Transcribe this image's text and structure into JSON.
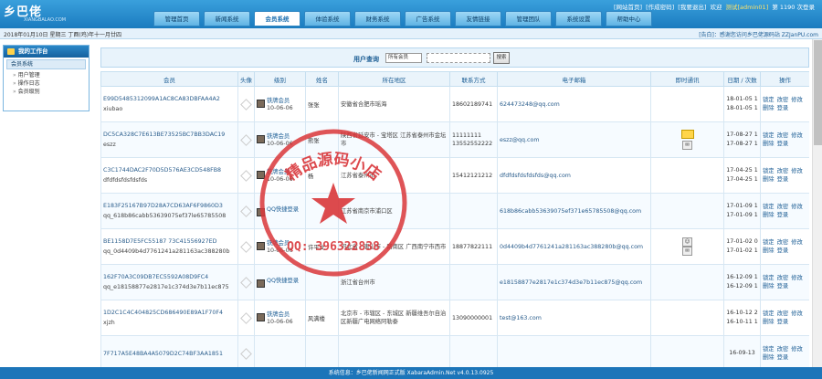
{
  "header": {
    "logo": "乡巴佬",
    "logo_sub": "XIANGBALAO.COM",
    "links": [
      "[网站首页]",
      "[作成密码]",
      "[我要退出]",
      "欢迎",
      "测试[admin01]",
      "第 1190 次登录"
    ]
  },
  "nav": [
    "管理首页",
    "新闻系统",
    "会员系统",
    "体验系统",
    "财务系统",
    "广告系统",
    "友情链接",
    "管理团队",
    "系统设置",
    "帮助中心"
  ],
  "nav_active": 2,
  "info_bar": {
    "date": "2018年01月10日 星期三 丁酉(鸡)年十一月廿四",
    "notice": "[告白]：感谢您访问乡巴佬源码站 ZZJanPU.com"
  },
  "sidebar": {
    "title": "我的工作台",
    "group": "会员系统",
    "items": [
      "用户管理",
      "操作日志",
      "会员级别"
    ]
  },
  "filter": {
    "label": "用户查询",
    "select": "所有会员",
    "button": "搜索"
  },
  "table": {
    "headers": [
      "会员",
      "头像",
      "级别",
      "姓名",
      "所在地区",
      "联系方式",
      "电子邮箱",
      "即时通讯",
      "日期 / 次数",
      "操作"
    ],
    "rows": [
      {
        "id": "E99D5485312099A1AC8CA83DBFAA4A2",
        "name": "xiubao",
        "level": "铁牌会员",
        "level_date": "10-06-06",
        "realname": "张张",
        "region": "安徽省合肥市瑶海",
        "phone": "18602189741",
        "email": "624473248@qq.com",
        "im": "",
        "date1": "18-01-05",
        "date2": "18-01-05",
        "count1": "1",
        "count2": "1"
      },
      {
        "id": "DC5CA328C7E613BE73525BC7BB3DAC19",
        "name": "eszz",
        "level": "铁牌会员",
        "level_date": "10-06-06",
        "realname": "熊张",
        "region": "陕西省延安市 - 宝塔区 江苏省泰州市金坛市",
        "phone": "11111111 13552552222",
        "email": "eszz@qq.com",
        "im": "QQ",
        "date1": "17-08-27",
        "date2": "17-08-27",
        "count1": "1",
        "count2": "1"
      },
      {
        "id": "C3C1744DAC2F70D5D576AE3CD548FB8",
        "name": "dfdfdsfdsfdsfds",
        "level": "铁牌会员",
        "level_date": "10-06-06",
        "realname": "杨",
        "region": "江苏省泰州市",
        "phone": "15412121212",
        "email": "dfdfdsfdsfdsfds@qq.com",
        "im": "",
        "date1": "17-04-25",
        "date2": "17-04-25",
        "count1": "1",
        "count2": "1"
      },
      {
        "id": "E183F25167B97D28A7CD63AF6F9860D3",
        "name": "qq_618b86cabb53639075ef37le65785508",
        "level": "QQ快捷登录",
        "level_date": "",
        "realname": "",
        "region": "江苏省南京市浦口区",
        "phone": "",
        "email": "618b86cabb53639075ef371e65785508@qq.com",
        "im": "",
        "date1": "17-01-09",
        "date2": "17-01-09",
        "count1": "1",
        "count2": "1"
      },
      {
        "id": "BE1158D7E5FC55187 73C41556927ED",
        "name": "qq_0d4409b4d7761241a281163ac388280b",
        "level": "铁牌会员",
        "level_date": "10-06-06",
        "realname": "许平文",
        "region": "河北省 - 唐山市 - 路南区 广西南宁市西市",
        "phone": "18877822111",
        "email": "0d4409b4d7761241a281163ac388280b@qq.com",
        "im": "QQ 旺旺",
        "date1": "17-01-02",
        "date2": "17-01-02",
        "count1": "0",
        "count2": "1"
      },
      {
        "id": "162F70A3C09DB7EC5592A08D9FC4",
        "name": "qq_e18158877e2817e1c374d3e7b11ec875",
        "level": "QQ快捷登录",
        "level_date": "",
        "realname": "",
        "region": "浙江省台州市",
        "phone": "",
        "email": "e18158877e2817e1c374d3e7b11ec875@qq.com",
        "im": "",
        "date1": "16-12-09",
        "date2": "16-12-09",
        "count1": "1",
        "count2": "1"
      },
      {
        "id": "1D2C1C4C404825CD686490E89A1F70F4",
        "name": "xjzh",
        "level": "铁牌会员",
        "level_date": "10-06-06",
        "realname": "风满楼",
        "region": "北京市 - 市辖区 - 东城区 新疆维吾尔自治区新疆广电网络阿勒泰",
        "phone": "13090000001",
        "email": "test@163.com",
        "im": "",
        "date1": "16-10-12",
        "date2": "16-10-11",
        "count1": "2",
        "count2": "1"
      },
      {
        "id": "7F717A5E48BA4A5079D2C74BF3AA1851",
        "name": "",
        "level": "",
        "level_date": "",
        "realname": "",
        "region": "",
        "phone": "",
        "email": "",
        "im": "",
        "date1": "16-09-13",
        "date2": "",
        "count1": "",
        "count2": ""
      }
    ],
    "ops": [
      "锁定",
      "改密",
      "修改",
      "删除",
      "登录"
    ]
  },
  "stamp": {
    "text": "精品源码小店",
    "qq": "QQ: 396322838"
  },
  "footer": "系统信息：乡巴佬新闻网正式版 XabaraAdmin.Net v4.0.13.0925",
  "colors": {
    "accent": "#1c75b9",
    "stamp": "#d9363a"
  }
}
